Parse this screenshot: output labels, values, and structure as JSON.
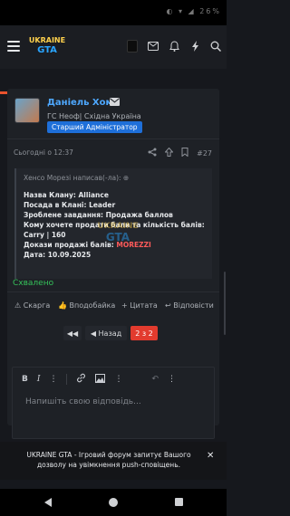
{
  "status_bar": {
    "icons_text": "◐ ▾ ◢ 26%"
  },
  "header": {
    "logo_line1": "UKRAINE",
    "logo_line2": "GTA",
    "icons": [
      "menu-icon",
      "avatar",
      "mail-icon",
      "bell-icon",
      "bolt-icon",
      "search-icon"
    ]
  },
  "post": {
    "author": "Даніель Хомс",
    "user_title": "ГС Неоф| Східна Україна",
    "role_badge": "Старший Адміністратор",
    "date": "Сьогодні о 12:37",
    "post_number": "#27",
    "quote": {
      "header": "Хенсо Морезі написав(-ла): ⊕",
      "lines": [
        "Назва Клану: Alliance",
        "Посада в Клані: Leader",
        "Зроблене завдання: Продажа баллов",
        "Кому хочете продати бали та кількість балів:",
        "Carry | 160",
        "Докази продажі балів: ",
        "Дата: 10.09.2025"
      ],
      "proof_link": "MOREZZI",
      "watermark_line1": "UKRAINE",
      "watermark_line2": "GTA"
    },
    "status": "Схвалено",
    "actions": {
      "complaint": "⚠ Скарга",
      "like": "👍 Вподобайка",
      "quote": "+ Цитата",
      "reply": "↩ Відповісти"
    }
  },
  "pagination": {
    "first": "◀◀",
    "prev": "◀  Назад",
    "current": "2 з 2"
  },
  "editor": {
    "placeholder": "Напишіть свою відповідь..."
  },
  "toast": {
    "text": "UKRAINE GTA - Ігровий форум запитує Вашого дозволу на увімкнення push-сповіщень.",
    "close": "✕"
  }
}
